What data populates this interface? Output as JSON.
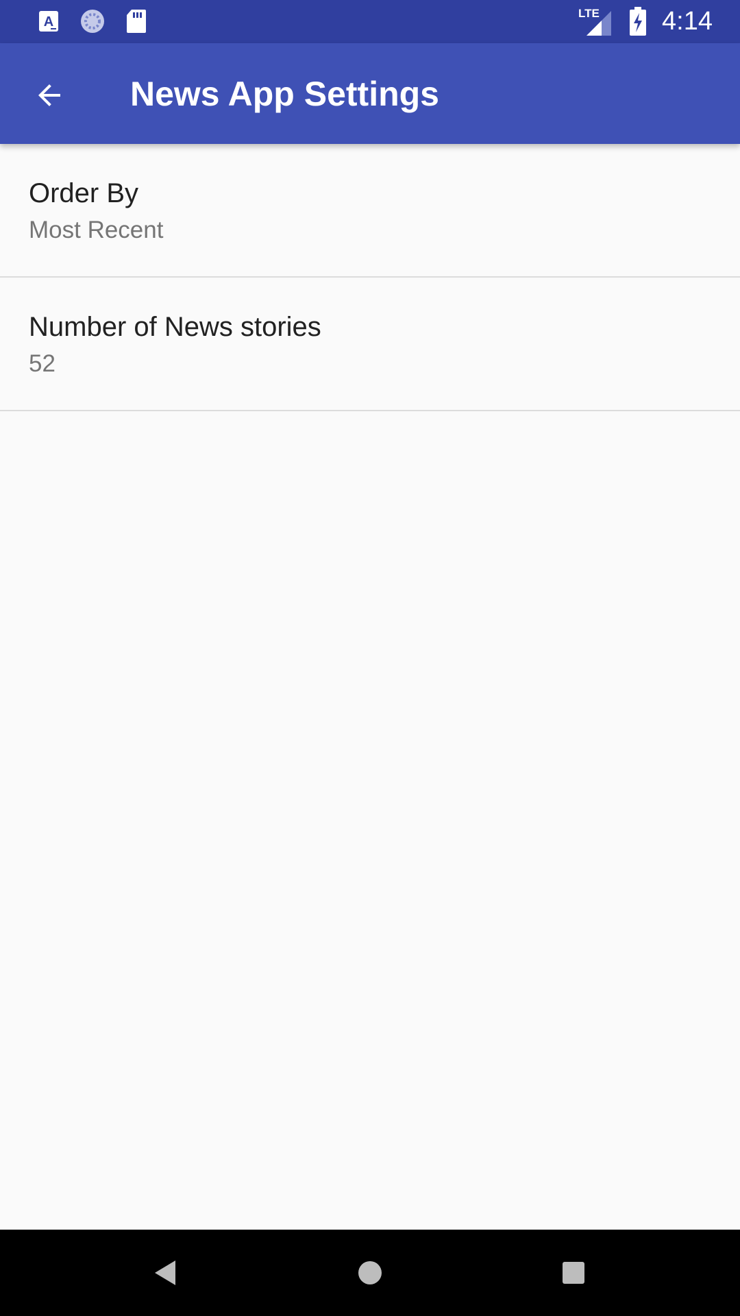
{
  "status_bar": {
    "icons_left": [
      "accessibility-a-icon",
      "loading-circle-icon",
      "sd-card-icon"
    ],
    "network_label": "LTE",
    "time": "4:14"
  },
  "app_bar": {
    "title": "News App Settings",
    "back_icon": "arrow-back-icon",
    "color": "#3f51b5"
  },
  "preferences": [
    {
      "title": "Order By",
      "summary": "Most Recent"
    },
    {
      "title": "Number of News stories",
      "summary": "52"
    }
  ],
  "nav_bar": {
    "buttons": [
      "back-triangle-icon",
      "home-circle-icon",
      "recents-square-icon"
    ]
  }
}
